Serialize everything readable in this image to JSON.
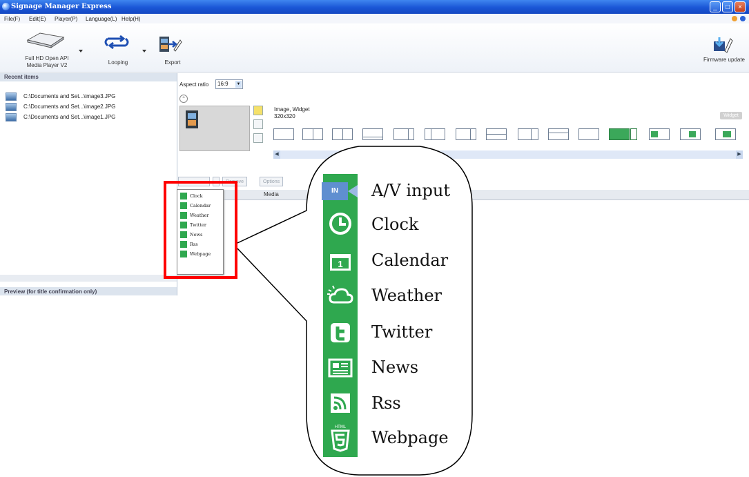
{
  "window": {
    "title": "Signage Manager Express",
    "controls": [
      "_",
      "□",
      "×"
    ]
  },
  "menu": [
    "File(F)",
    "Edit(E)",
    "Player(P)",
    "Language(L)",
    "Help(H)"
  ],
  "toolbar": {
    "device_label_1": "Full HD Open API",
    "device_label_2": "Media Player V2",
    "looping_label": "Looping",
    "export_label": "Export",
    "firmware_label": "Firmware update"
  },
  "left_pane": {
    "recent_header": "Recent items",
    "recent_items": [
      "C:\\Documents and Set...\\image3.JPG",
      "C:\\Documents and Set...\\image2.JPG",
      "C:\\Documents and Set...\\image1.JPG"
    ],
    "preview_header": "Preview (for title confirmation only)"
  },
  "editor": {
    "aspect_label": "Aspect ratio",
    "aspect_value": "16:9",
    "media_type": "Image, Widget",
    "media_size": "320x320",
    "widget_tag": "Widget",
    "remove_label": "Remove",
    "options_label": "Options",
    "column_media": "Media"
  },
  "widget_menu": [
    "Clock",
    "Calendar",
    "Weather",
    "Twitter",
    "News",
    "Rss",
    "Webpage"
  ],
  "callout": {
    "items": [
      "A/V input",
      "Clock",
      "Calendar",
      "Weather",
      "Twitter",
      "News",
      "Rss",
      "Webpage"
    ],
    "av_icon_text": "IN",
    "calendar_icon_text": "1",
    "webpage_icon_text": "HTML"
  },
  "colors": {
    "titlebar": "#1a56d6",
    "widget_green": "#2fa84f",
    "highlight": "#ff0000"
  },
  "icons": [
    "clock-icon",
    "calendar-icon",
    "weather-icon",
    "twitter-icon",
    "news-icon",
    "rss-icon",
    "html5-icon",
    "av-input-icon"
  ]
}
